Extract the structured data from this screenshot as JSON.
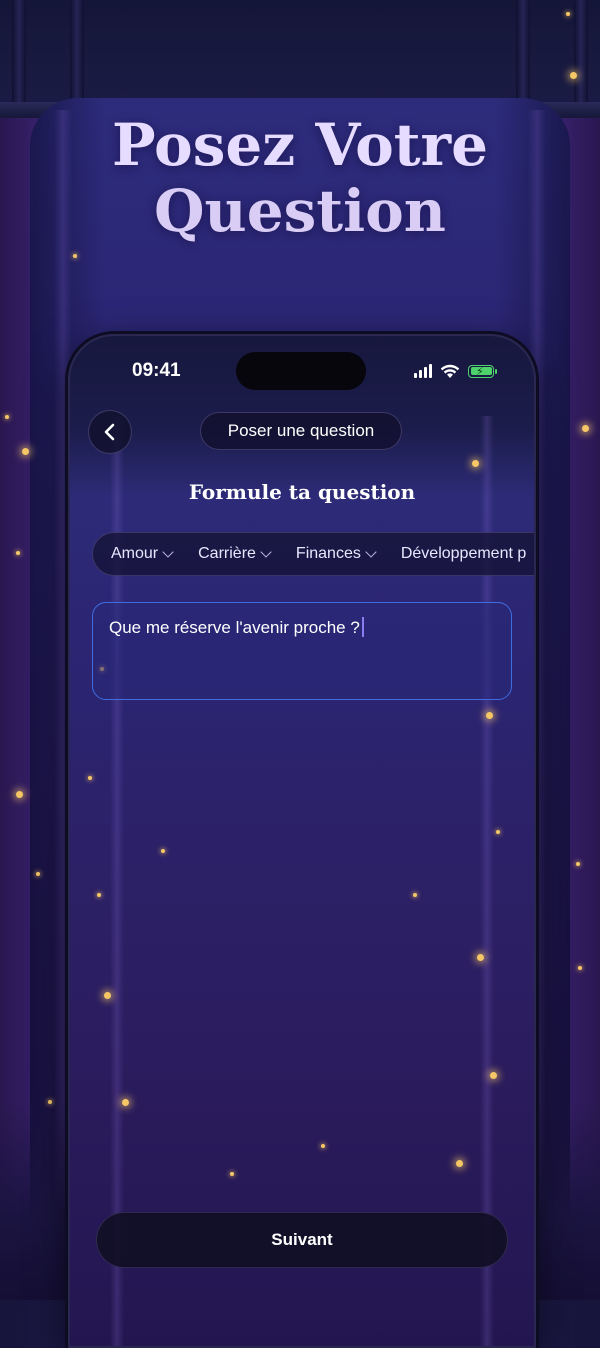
{
  "hero": {
    "title_line1": "Posez Votre",
    "title_line2": "Question"
  },
  "statusbar": {
    "time": "09:41"
  },
  "header": {
    "back_icon": "chevron-left-icon",
    "title": "Poser une question"
  },
  "section": {
    "title": "Formule ta question"
  },
  "categories": [
    {
      "label": "Amour"
    },
    {
      "label": "Carrière"
    },
    {
      "label": "Finances"
    },
    {
      "label": "Développement p"
    }
  ],
  "question": {
    "value": "Que me réserve l'avenir proche ?"
  },
  "footer": {
    "next_label": "Suivant"
  },
  "colors": {
    "accent_border": "#3f6de0",
    "spark": "#f6c766",
    "battery": "#4ed36c"
  }
}
